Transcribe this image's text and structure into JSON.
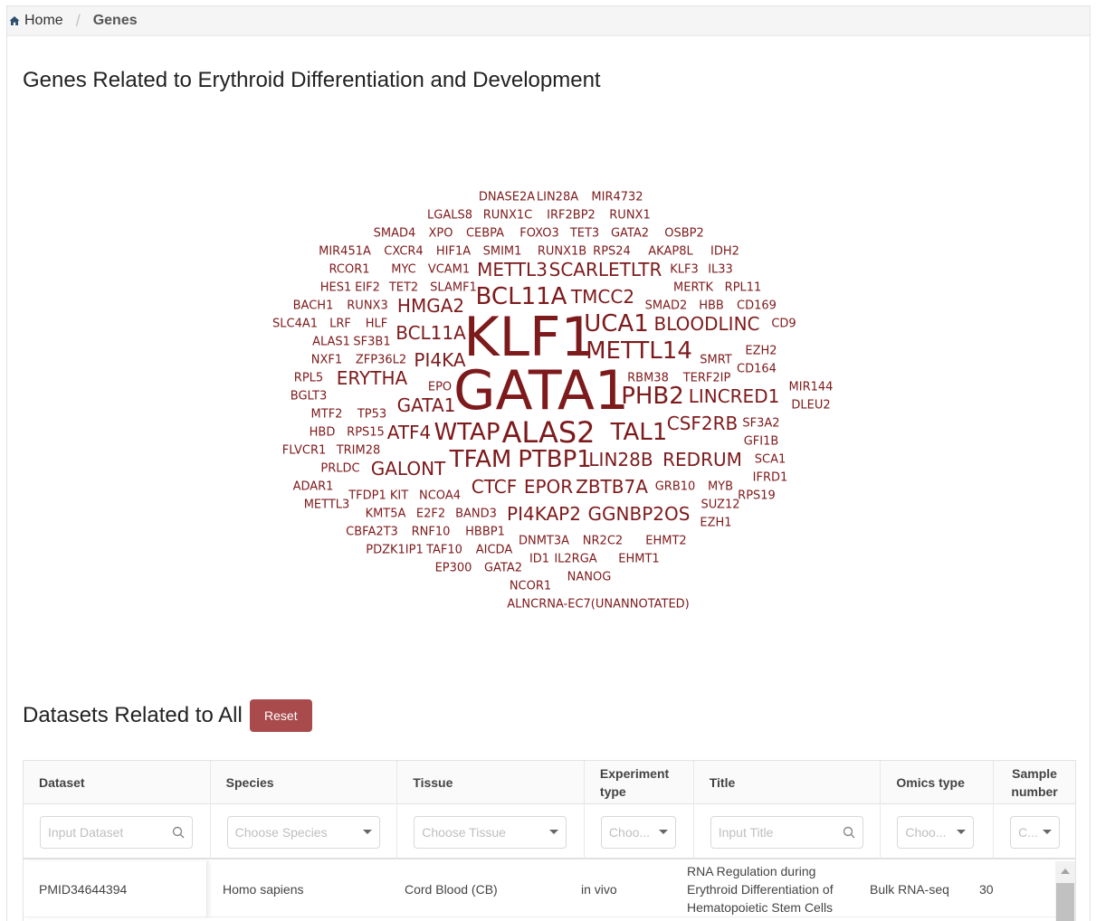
{
  "breadcrumb": {
    "home": "Home",
    "current": "Genes"
  },
  "page_title": "Genes Related to Erythroid Differentiation and Development",
  "wordcloud": [
    {
      "t": "DNASE2A",
      "s": 13
    },
    {
      "t": "LIN28A",
      "s": 13
    },
    {
      "t": "MIR4732",
      "s": 13
    },
    {
      "t": "LGALS8",
      "s": 13
    },
    {
      "t": "RUNX1C",
      "s": 13
    },
    {
      "t": "IRF2BP2",
      "s": 13
    },
    {
      "t": "RUNX1",
      "s": 13
    },
    {
      "t": "SMAD4",
      "s": 13
    },
    {
      "t": "XPO",
      "s": 13
    },
    {
      "t": "CEBPA",
      "s": 13
    },
    {
      "t": "FOXO3",
      "s": 13
    },
    {
      "t": "TET3",
      "s": 13
    },
    {
      "t": "GATA2",
      "s": 13
    },
    {
      "t": "OSBP2",
      "s": 13
    },
    {
      "t": "MIR451A",
      "s": 13
    },
    {
      "t": "CXCR4",
      "s": 13
    },
    {
      "t": "HIF1A",
      "s": 13
    },
    {
      "t": "SMIM1",
      "s": 13
    },
    {
      "t": "RUNX1B",
      "s": 13
    },
    {
      "t": "RPS24",
      "s": 13
    },
    {
      "t": "AKAP8L",
      "s": 13
    },
    {
      "t": "IDH2",
      "s": 13
    },
    {
      "t": "RCOR1",
      "s": 13
    },
    {
      "t": "MYC",
      "s": 13
    },
    {
      "t": "VCAM1",
      "s": 13
    },
    {
      "t": "METTL3",
      "s": 20
    },
    {
      "t": "SCARLETLTR",
      "s": 20
    },
    {
      "t": "KLF3",
      "s": 13
    },
    {
      "t": "IL33",
      "s": 13
    },
    {
      "t": "HES1",
      "s": 13
    },
    {
      "t": "EIF2",
      "s": 13
    },
    {
      "t": "TET2",
      "s": 13
    },
    {
      "t": "SLAMF1",
      "s": 13
    },
    {
      "t": "MERTK",
      "s": 13
    },
    {
      "t": "RPL11",
      "s": 13
    },
    {
      "t": "BCL11A",
      "s": 26
    },
    {
      "t": "TMCC2",
      "s": 20
    },
    {
      "t": "BACH1",
      "s": 13
    },
    {
      "t": "RUNX3",
      "s": 13
    },
    {
      "t": "HMGA2",
      "s": 20
    },
    {
      "t": "SMAD2",
      "s": 13
    },
    {
      "t": "HBB",
      "s": 13
    },
    {
      "t": "CD169",
      "s": 13
    },
    {
      "t": "SLC4A1",
      "s": 13
    },
    {
      "t": "LRF",
      "s": 13
    },
    {
      "t": "HLF",
      "s": 13
    },
    {
      "t": "BCL11A",
      "s": 20
    },
    {
      "t": "KLF1",
      "s": 60
    },
    {
      "t": "UCA1",
      "s": 26
    },
    {
      "t": "BLOODLINC",
      "s": 20
    },
    {
      "t": "CD9",
      "s": 13
    },
    {
      "t": "ALAS1",
      "s": 13
    },
    {
      "t": "SF3B1",
      "s": 13
    },
    {
      "t": "METTL14",
      "s": 26
    },
    {
      "t": "NXF1",
      "s": 13
    },
    {
      "t": "ZFP36L2",
      "s": 13
    },
    {
      "t": "PI4KA",
      "s": 20
    },
    {
      "t": "EZH2",
      "s": 13
    },
    {
      "t": "SMRT",
      "s": 13
    },
    {
      "t": "RPL5",
      "s": 13
    },
    {
      "t": "ERYTHA",
      "s": 20
    },
    {
      "t": "RBM38",
      "s": 13
    },
    {
      "t": "TERF2IP",
      "s": 13
    },
    {
      "t": "CD164",
      "s": 13
    },
    {
      "t": "EPO",
      "s": 13
    },
    {
      "t": "GATA1",
      "s": 60
    },
    {
      "t": "MIR144",
      "s": 13
    },
    {
      "t": "BGLT3",
      "s": 13
    },
    {
      "t": "PHB2",
      "s": 26
    },
    {
      "t": "LINCRED1",
      "s": 20
    },
    {
      "t": "GATA1",
      "s": 20
    },
    {
      "t": "DLEU2",
      "s": 13
    },
    {
      "t": "MTF2",
      "s": 13
    },
    {
      "t": "TP53",
      "s": 13
    },
    {
      "t": "HBD",
      "s": 13
    },
    {
      "t": "RPS15",
      "s": 13
    },
    {
      "t": "ATF4",
      "s": 20
    },
    {
      "t": "WTAP",
      "s": 26
    },
    {
      "t": "ALAS2",
      "s": 32
    },
    {
      "t": "TAL1",
      "s": 26
    },
    {
      "t": "CSF2RB",
      "s": 20
    },
    {
      "t": "SF3A2",
      "s": 13
    },
    {
      "t": "FLVCR1",
      "s": 13
    },
    {
      "t": "TRIM28",
      "s": 13
    },
    {
      "t": "GFI1B",
      "s": 13
    },
    {
      "t": "TFAM",
      "s": 26
    },
    {
      "t": "PTBP1",
      "s": 26
    },
    {
      "t": "LIN28B",
      "s": 20
    },
    {
      "t": "REDRUM",
      "s": 20
    },
    {
      "t": "SCA1",
      "s": 13
    },
    {
      "t": "PRLDC",
      "s": 13
    },
    {
      "t": "GALONT",
      "s": 20
    },
    {
      "t": "IFRD1",
      "s": 13
    },
    {
      "t": "ADAR1",
      "s": 13
    },
    {
      "t": "CTCF",
      "s": 20
    },
    {
      "t": "EPOR",
      "s": 20
    },
    {
      "t": "ZBTB7A",
      "s": 20
    },
    {
      "t": "GRB10",
      "s": 13
    },
    {
      "t": "MYB",
      "s": 13
    },
    {
      "t": "TFDP1",
      "s": 13
    },
    {
      "t": "KIT",
      "s": 13
    },
    {
      "t": "NCOA4",
      "s": 13
    },
    {
      "t": "RPS19",
      "s": 13
    },
    {
      "t": "METTL3",
      "s": 13
    },
    {
      "t": "SUZ12",
      "s": 13
    },
    {
      "t": "KMT5A",
      "s": 13
    },
    {
      "t": "E2F2",
      "s": 13
    },
    {
      "t": "BAND3",
      "s": 13
    },
    {
      "t": "PI4KAP2",
      "s": 20
    },
    {
      "t": "GGNBP2OS",
      "s": 20
    },
    {
      "t": "EZH1",
      "s": 13
    },
    {
      "t": "CBFA2T3",
      "s": 13
    },
    {
      "t": "RNF10",
      "s": 13
    },
    {
      "t": "HBBP1",
      "s": 13
    },
    {
      "t": "DNMT3A",
      "s": 13
    },
    {
      "t": "NR2C2",
      "s": 13
    },
    {
      "t": "EHMT2",
      "s": 13
    },
    {
      "t": "PDZK1IP1",
      "s": 13
    },
    {
      "t": "TAF10",
      "s": 13
    },
    {
      "t": "AICDA",
      "s": 13
    },
    {
      "t": "ID1",
      "s": 13
    },
    {
      "t": "IL2RGA",
      "s": 13
    },
    {
      "t": "EHMT1",
      "s": 13
    },
    {
      "t": "EP300",
      "s": 13
    },
    {
      "t": "GATA2",
      "s": 13
    },
    {
      "t": "NANOG",
      "s": 13
    },
    {
      "t": "NCOR1",
      "s": 13
    },
    {
      "t": "ALNCRNA-EC7(UNANNOTATED)",
      "s": 13
    }
  ],
  "datasets": {
    "title": "Datasets Related to All",
    "reset_label": "Reset",
    "columns": [
      "Dataset",
      "Species",
      "Tissue",
      "Experiment type",
      "Title",
      "Omics type",
      "Sample number"
    ],
    "filters": [
      "Input Dataset",
      "Choose Species",
      "Choose Tissue",
      "Choo...",
      "Input Title",
      "Choo...",
      "C..."
    ],
    "rows": [
      {
        "dataset": "PMID34644394",
        "species": "Homo sapiens",
        "tissue": "Cord Blood (CB)",
        "experiment": "in vivo",
        "title": "RNA Regulation during Erythroid Differentiation of Hematopoietic Stem Cells",
        "omics": "Bulk RNA-seq",
        "samples": "30"
      }
    ]
  },
  "colors": {
    "word": "#7d1a1c",
    "reset": "#a94a4d"
  }
}
